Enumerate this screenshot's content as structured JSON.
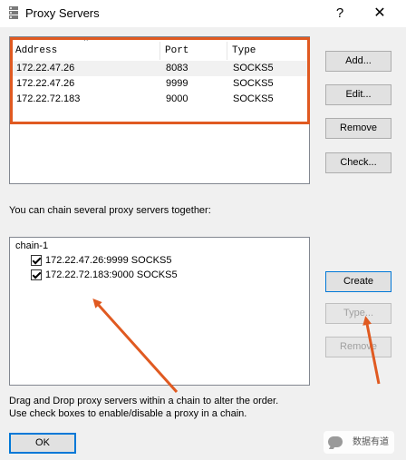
{
  "window": {
    "title": "Proxy Servers",
    "help_glyph": "?",
    "close_glyph": "✕"
  },
  "server_list": {
    "columns": [
      "Address",
      "Port",
      "Type"
    ],
    "rows": [
      {
        "address": "172.22.47.26",
        "port": "8083",
        "type": "SOCKS5"
      },
      {
        "address": "172.22.47.26",
        "port": "9999",
        "type": "SOCKS5"
      },
      {
        "address": "172.22.72.183",
        "port": "9000",
        "type": "SOCKS5"
      }
    ]
  },
  "buttons": {
    "add": "Add...",
    "edit": "Edit...",
    "remove": "Remove",
    "check": "Check...",
    "create": "Create",
    "type": "Type...",
    "remove_chain": "Remove",
    "ok": "OK"
  },
  "chain_section": {
    "label": "You can chain several proxy servers together:",
    "chain_name": "chain-1",
    "items": [
      {
        "text": "172.22.47.26:9999 SOCKS5",
        "checked": true
      },
      {
        "text": "172.22.72.183:9000 SOCKS5",
        "checked": true
      }
    ]
  },
  "help": {
    "line1": "Drag and Drop proxy servers within a chain to alter the order.",
    "line2": "Use check boxes to enable/disable a proxy in a chain."
  },
  "watermark": {
    "text": "数据有道"
  },
  "colors": {
    "annotation": "#e05a21",
    "focus_border": "#0078d7"
  }
}
